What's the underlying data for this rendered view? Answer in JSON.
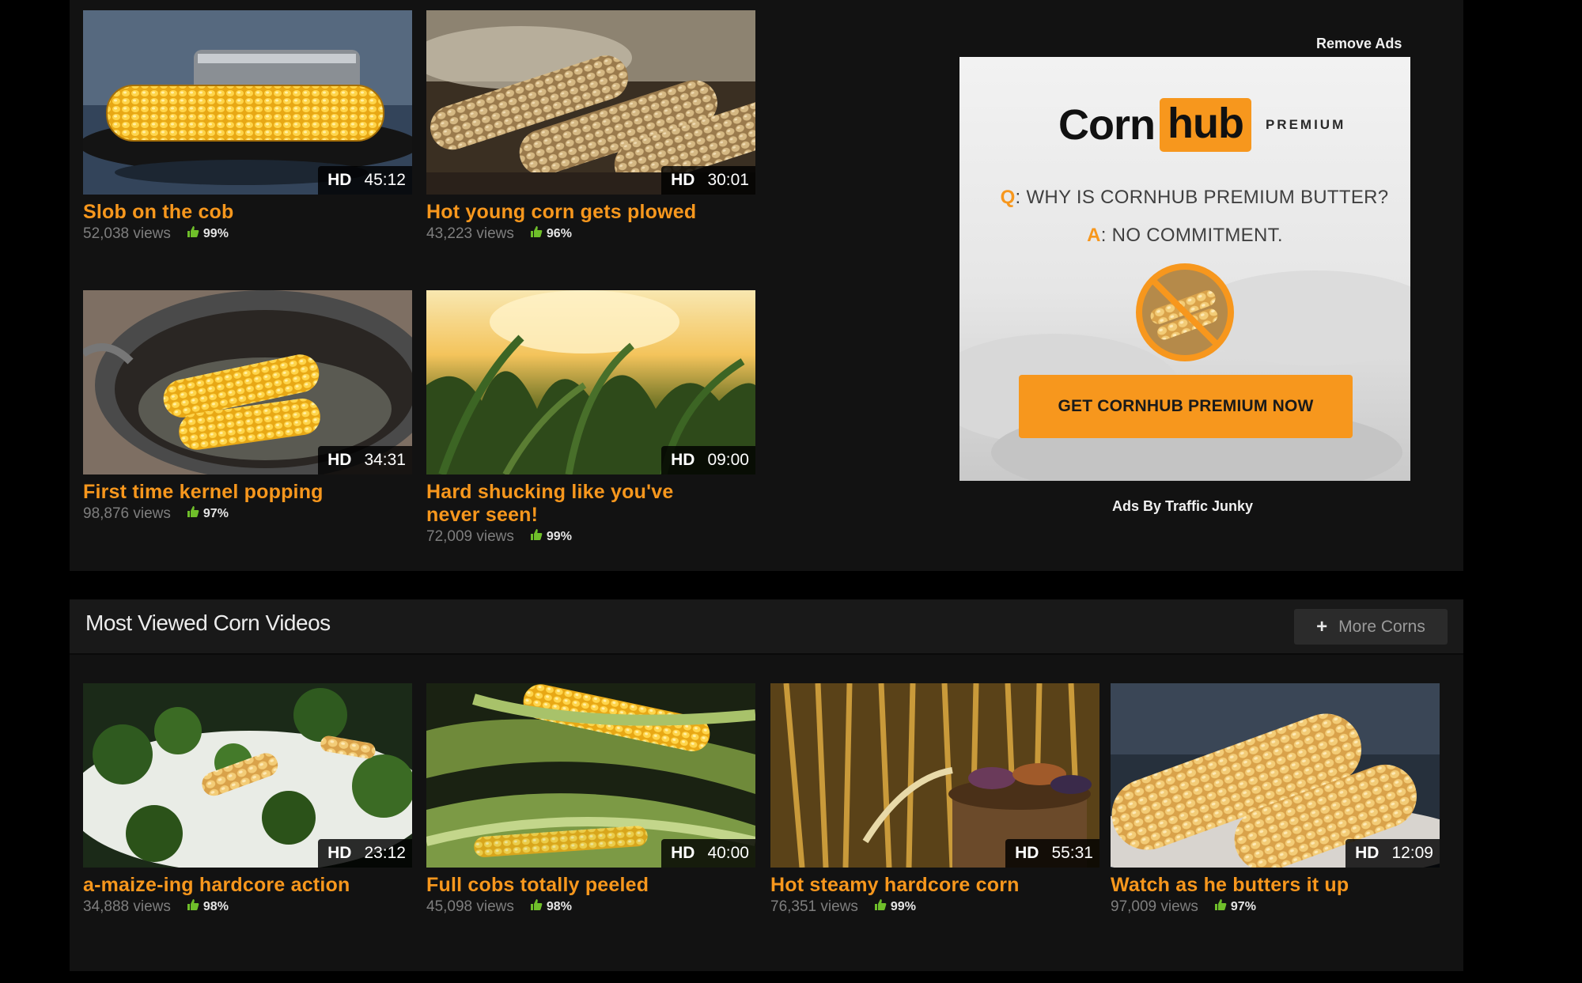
{
  "top_videos": [
    {
      "title": "Slob on the cob",
      "views": "52,038 views",
      "rating": "99%",
      "hd": "HD",
      "duration": "45:12",
      "thumb": "corn-in-pan"
    },
    {
      "title": "Hot young corn gets plowed",
      "views": "43,223 views",
      "rating": "96%",
      "hd": "HD",
      "duration": "30:01",
      "thumb": "grilled-corn"
    },
    {
      "title": "First time kernel popping",
      "views": "98,876 views",
      "rating": "97%",
      "hd": "HD",
      "duration": "34:31",
      "thumb": "corn-in-pot"
    },
    {
      "title": "Hard shucking like you've never seen!",
      "views": "72,009 views",
      "rating": "99%",
      "hd": "HD",
      "duration": "09:00",
      "thumb": "corn-field-sunset"
    }
  ],
  "ad": {
    "remove_ads": "Remove Ads",
    "logo_corn": "Corn",
    "logo_hub": "hub",
    "logo_premium": "PREMIUM",
    "q_key": "Q",
    "q_text": ": WHY IS CORNHUB PREMIUM BUTTER?",
    "a_key": "A",
    "a_text": ": NO COMMITMENT.",
    "cta": "GET CORNHUB PREMIUM NOW",
    "ads_by": "Ads By Traffic Junky"
  },
  "most_viewed": {
    "title": "Most Viewed Corn Videos",
    "more_button": "More Corns",
    "videos": [
      {
        "title": "a-maize-ing hardcore action",
        "views": "34,888 views",
        "rating": "98%",
        "hd": "HD",
        "duration": "23:12",
        "thumb": "corn-broccoli"
      },
      {
        "title": "Full cobs totally peeled",
        "views": "45,098 views",
        "rating": "98%",
        "hd": "HD",
        "duration": "40:00",
        "thumb": "husked-corn"
      },
      {
        "title": "Hot steamy hardcore corn",
        "views": "76,351 views",
        "rating": "99%",
        "hd": "HD",
        "duration": "55:31",
        "thumb": "corn-basket"
      },
      {
        "title": "Watch as he butters it up",
        "views": "97,009 views",
        "rating": "97%",
        "hd": "HD",
        "duration": "12:09",
        "thumb": "buttered-corn"
      }
    ]
  },
  "colors": {
    "accent": "#f7971d",
    "panel": "#121212",
    "page_bg": "#000000",
    "rating_icon": "#6fbf2a"
  },
  "icons": {
    "thumbs_up": "thumbs-up-icon",
    "plus": "plus-icon"
  }
}
